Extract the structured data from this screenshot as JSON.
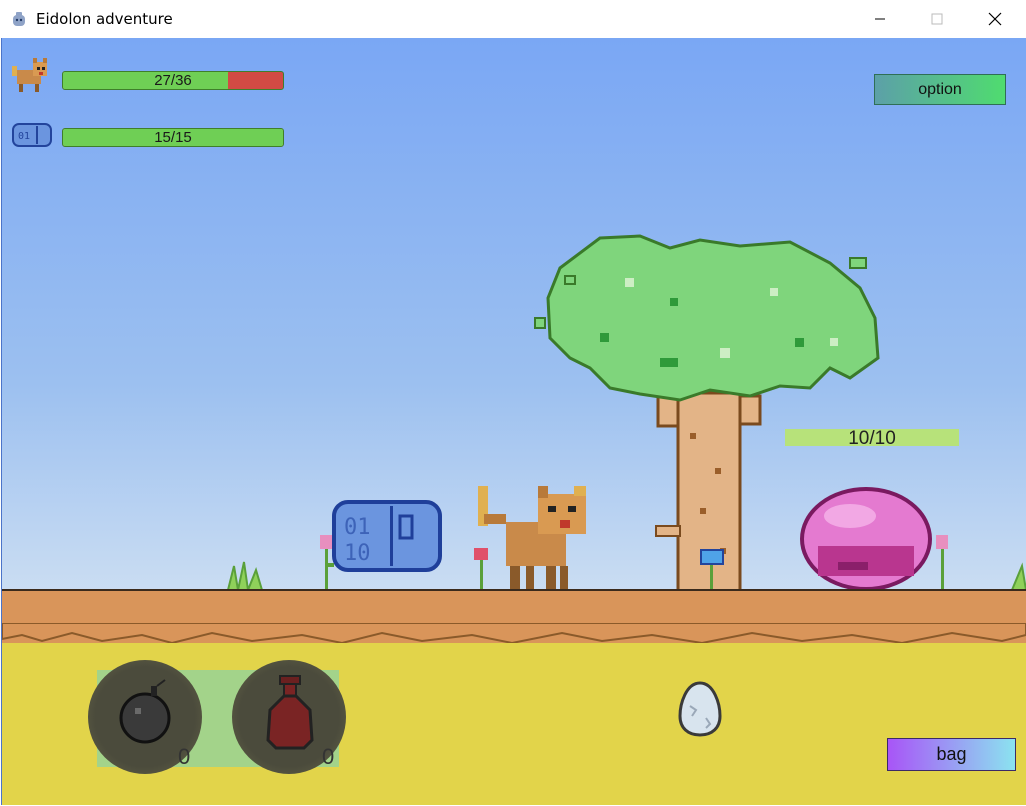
{
  "window": {
    "title": "Eidolon adventure",
    "controls": [
      "minimize-icon",
      "maximize-icon",
      "close-icon"
    ]
  },
  "party": [
    {
      "icon": "cat-creature-icon",
      "hp_current": 27,
      "hp_max": 36,
      "hp_text": "27/36"
    },
    {
      "icon": "blue-slime-icon",
      "hp_current": 15,
      "hp_max": 15,
      "hp_text": "15/15"
    }
  ],
  "enemy": {
    "icon": "pink-slime-icon",
    "hp_text": "10/10"
  },
  "buttons": {
    "option": "option",
    "bag": "bag"
  },
  "inventory": [
    {
      "icon": "bomb-icon",
      "count": "0"
    },
    {
      "icon": "potion-icon",
      "count": "0"
    }
  ],
  "egg": {
    "icon": "egg-icon"
  },
  "colors": {
    "hp_fill": "#6fcf55",
    "hp_empty": "#d24a44",
    "enemy_hp": "#b7e27a",
    "sky": "#7aa7f4",
    "dirt": "#d9955a",
    "ground": "#e2d44a"
  }
}
